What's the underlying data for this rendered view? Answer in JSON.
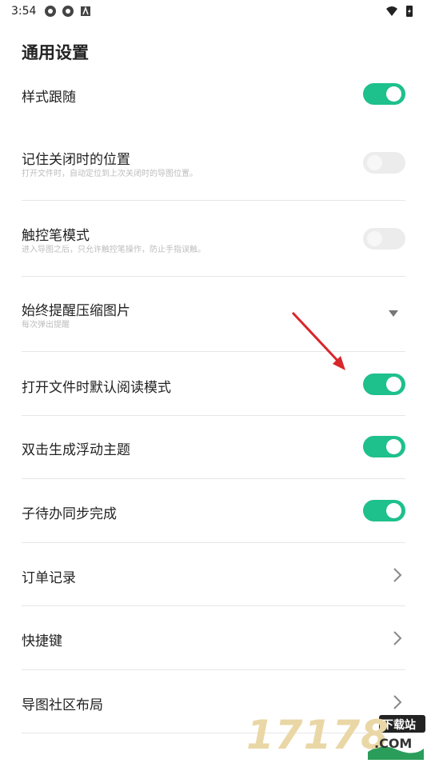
{
  "status": {
    "time": "3:54"
  },
  "page": {
    "title": "通用设置"
  },
  "settings": [
    {
      "label": "样式跟随",
      "control": "toggle",
      "on": true
    },
    {
      "label": "记住关闭时的位置",
      "sub": "打开文件时，自动定位到上次关闭时的导图位置。",
      "control": "toggle",
      "on": false
    },
    {
      "label": "触控笔模式",
      "sub": "进入导图之后，只允许触控笔操作，防止手指误触。",
      "control": "toggle",
      "on": false
    },
    {
      "label": "始终提醒压缩图片",
      "sub": "每次弹出提醒",
      "control": "dropdown"
    },
    {
      "label": "打开文件时默认阅读模式",
      "control": "toggle",
      "on": true
    },
    {
      "label": "双击生成浮动主题",
      "control": "toggle",
      "on": true
    },
    {
      "label": "子待办同步完成",
      "control": "toggle",
      "on": true
    },
    {
      "label": "订单记录",
      "control": "chevron"
    },
    {
      "label": "快捷键",
      "control": "chevron"
    },
    {
      "label": "导图社区布局",
      "control": "chevron"
    }
  ],
  "watermark": {
    "number": "17178",
    "tag": "下载站",
    "domain": ".COM"
  },
  "colors": {
    "accent": "#1ec08c",
    "annotation_arrow": "#d9262b"
  }
}
